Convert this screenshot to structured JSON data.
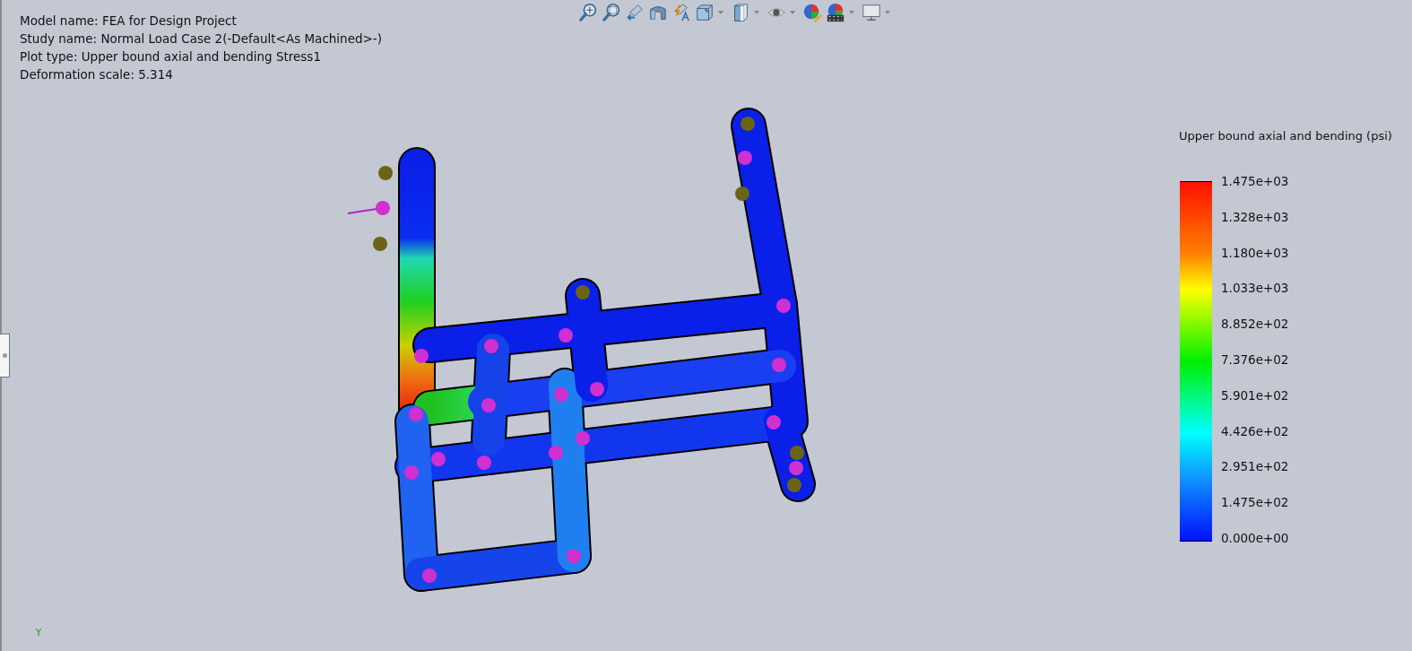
{
  "info": {
    "lines": [
      "Model name: FEA for Design Project",
      "Study name: Normal Load Case 2(-Default<As Machined>-)",
      "Plot type: Upper bound axial and bending Stress1",
      "Deformation scale: 5.314"
    ]
  },
  "toolbar": {
    "items": [
      {
        "kind": "zoomfit",
        "has_dropdown": false
      },
      {
        "kind": "zoomarea",
        "has_dropdown": false
      },
      {
        "kind": "previous",
        "has_dropdown": false
      },
      {
        "kind": "section",
        "has_dropdown": false
      },
      {
        "kind": "annotation",
        "has_dropdown": false
      },
      {
        "kind": "orientation",
        "has_dropdown": true
      },
      {
        "kind": "display",
        "has_dropdown": true
      },
      {
        "kind": "eye",
        "has_dropdown": true
      },
      {
        "kind": "appearance",
        "has_dropdown": false
      },
      {
        "kind": "scene",
        "has_dropdown": true
      },
      {
        "kind": "monitor",
        "has_dropdown": true
      }
    ]
  },
  "legend": {
    "title": "Upper bound axial and bending (psi)",
    "ticks": [
      "1.475e+03",
      "1.328e+03",
      "1.180e+03",
      "1.033e+03",
      "8.852e+02",
      "7.376e+02",
      "5.901e+02",
      "4.426e+02",
      "2.951e+02",
      "1.475e+02",
      "0.000e+00"
    ]
  },
  "triad": {
    "label": "Y"
  }
}
